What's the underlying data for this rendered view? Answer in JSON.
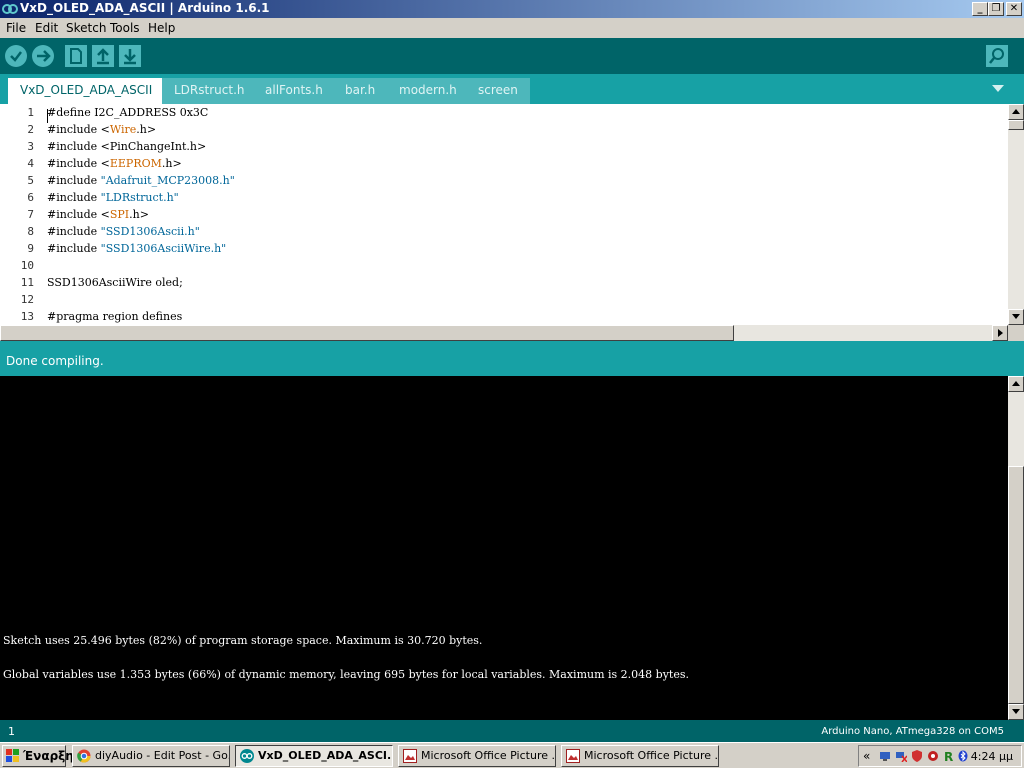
{
  "window": {
    "title": "VxD_OLED_ADA_ASCII | Arduino 1.6.1"
  },
  "menu": [
    "File",
    "Edit",
    "Sketch",
    "Tools",
    "Help"
  ],
  "tabs": [
    "VxD_OLED_ADA_ASCII",
    "LDRstruct.h",
    "allFonts.h",
    "bar.h",
    "modern.h",
    "screen"
  ],
  "editor": {
    "lines": [
      {
        "n": "1",
        "parts": [
          {
            "t": "#define I2C_ADDRESS 0x3C",
            "c": ""
          }
        ]
      },
      {
        "n": "2",
        "parts": [
          {
            "t": "#include <",
            "c": ""
          },
          {
            "t": "Wire",
            "c": "kw"
          },
          {
            "t": ".h>",
            "c": ""
          }
        ]
      },
      {
        "n": "3",
        "parts": [
          {
            "t": "#include <PinChangeInt.h>",
            "c": ""
          }
        ]
      },
      {
        "n": "4",
        "parts": [
          {
            "t": "#include <",
            "c": ""
          },
          {
            "t": "EEPROM",
            "c": "kw"
          },
          {
            "t": ".h>",
            "c": ""
          }
        ]
      },
      {
        "n": "5",
        "parts": [
          {
            "t": "#include ",
            "c": ""
          },
          {
            "t": "\"Adafruit_MCP23008.h\"",
            "c": "str"
          }
        ]
      },
      {
        "n": "6",
        "parts": [
          {
            "t": "#include ",
            "c": ""
          },
          {
            "t": "\"LDRstruct.h\"",
            "c": "str"
          }
        ]
      },
      {
        "n": "7",
        "parts": [
          {
            "t": "#include <",
            "c": ""
          },
          {
            "t": "SPI",
            "c": "kw"
          },
          {
            "t": ".h>",
            "c": ""
          }
        ]
      },
      {
        "n": "8",
        "parts": [
          {
            "t": "#include ",
            "c": ""
          },
          {
            "t": "\"SSD1306Ascii.h\"",
            "c": "str"
          }
        ]
      },
      {
        "n": "9",
        "parts": [
          {
            "t": "#include ",
            "c": ""
          },
          {
            "t": "\"SSD1306AsciiWire.h\"",
            "c": "str"
          }
        ]
      },
      {
        "n": "10",
        "parts": [
          {
            "t": "",
            "c": ""
          }
        ]
      },
      {
        "n": "11",
        "parts": [
          {
            "t": "SSD1306AsciiWire oled;",
            "c": ""
          }
        ]
      },
      {
        "n": "12",
        "parts": [
          {
            "t": "",
            "c": ""
          }
        ]
      },
      {
        "n": "13",
        "parts": [
          {
            "t": "#pragma region defines",
            "c": ""
          }
        ]
      }
    ]
  },
  "status": {
    "message": "Done compiling."
  },
  "console": {
    "line1": "Sketch uses 25.496 bytes (82%) of program storage space. Maximum is 30.720 bytes.",
    "line2": "Global variables use 1.353 bytes (66%) of dynamic memory, leaving 695 bytes for local variables. Maximum is 2.048 bytes."
  },
  "footer": {
    "line_number": "1",
    "board": "Arduino Nano, ATmega328 on COM5"
  },
  "taskbar": {
    "start": "Έναρξη",
    "tasks": [
      {
        "label": "diyAudio - Edit Post - Go...",
        "icon": "chrome-icon"
      },
      {
        "label": "VxD_OLED_ADA_ASCI...",
        "icon": "arduino-icon"
      },
      {
        "label": "Microsoft Office Picture ...",
        "icon": "picture-manager-icon"
      },
      {
        "label": "Microsoft Office Picture ...",
        "icon": "picture-manager-icon"
      }
    ],
    "clock": "4:24 μμ"
  },
  "colors": {
    "toolbar": "#006468",
    "tabbar": "#17a1a5",
    "keyword": "#cc6600",
    "string": "#006699"
  }
}
